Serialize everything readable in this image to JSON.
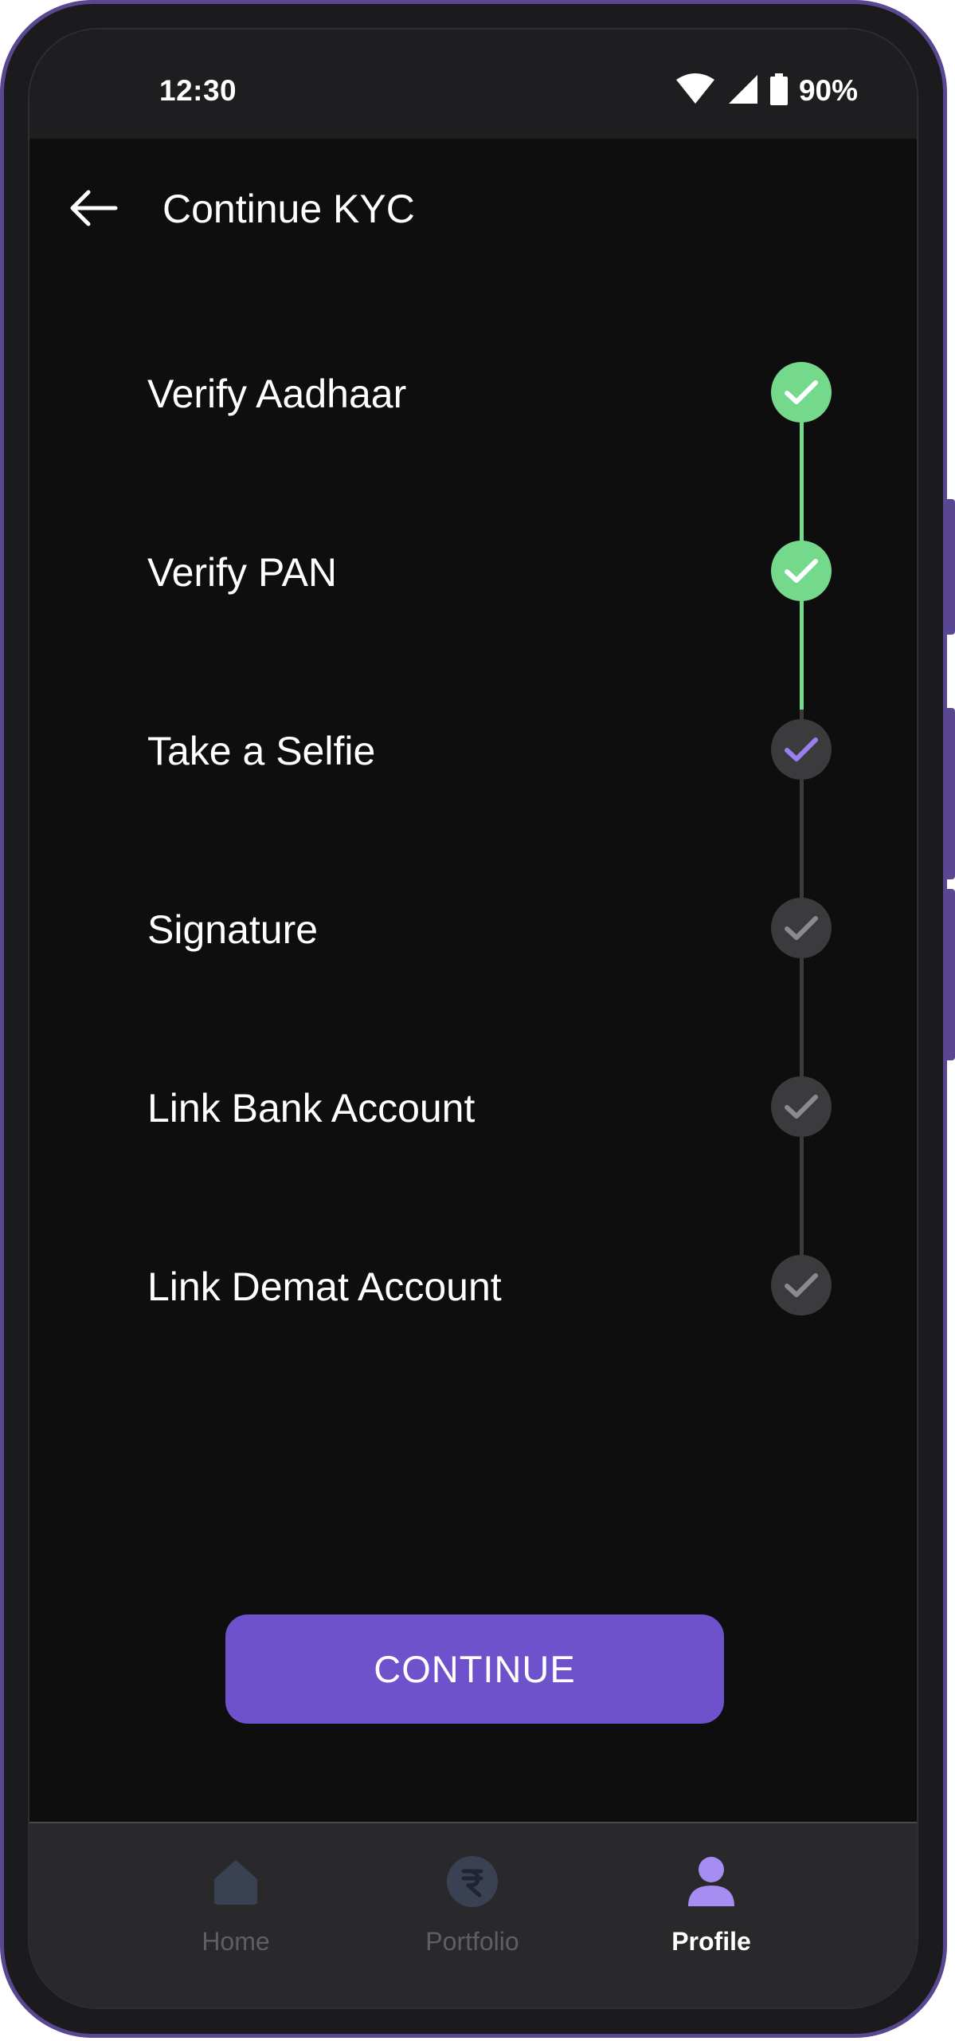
{
  "status_bar": {
    "time": "12:30",
    "battery": "90%"
  },
  "app_bar": {
    "title": "Continue KYC",
    "back_icon": "arrow-left-icon"
  },
  "steps": [
    {
      "label": "Verify Aadhaar",
      "status": "completed"
    },
    {
      "label": "Verify PAN",
      "status": "completed"
    },
    {
      "label": "Take a Selfie",
      "status": "current"
    },
    {
      "label": "Signature",
      "status": "pending"
    },
    {
      "label": "Link Bank Account",
      "status": "pending"
    },
    {
      "label": "Link Demat Account",
      "status": "pending"
    }
  ],
  "continue_button": {
    "label": "CONTINUE"
  },
  "bottom_nav": {
    "items": [
      {
        "label": "Home",
        "icon": "home-icon",
        "active": false
      },
      {
        "label": "Portfolio",
        "icon": "rupee-icon",
        "active": false
      },
      {
        "label": "Profile",
        "icon": "person-icon",
        "active": true
      }
    ]
  },
  "colors": {
    "completed": "#74d98b",
    "accent": "#6e52cc",
    "current_check": "#9a7ff0",
    "pending_check": "#8a8a8c",
    "frame": "#5a4791"
  }
}
